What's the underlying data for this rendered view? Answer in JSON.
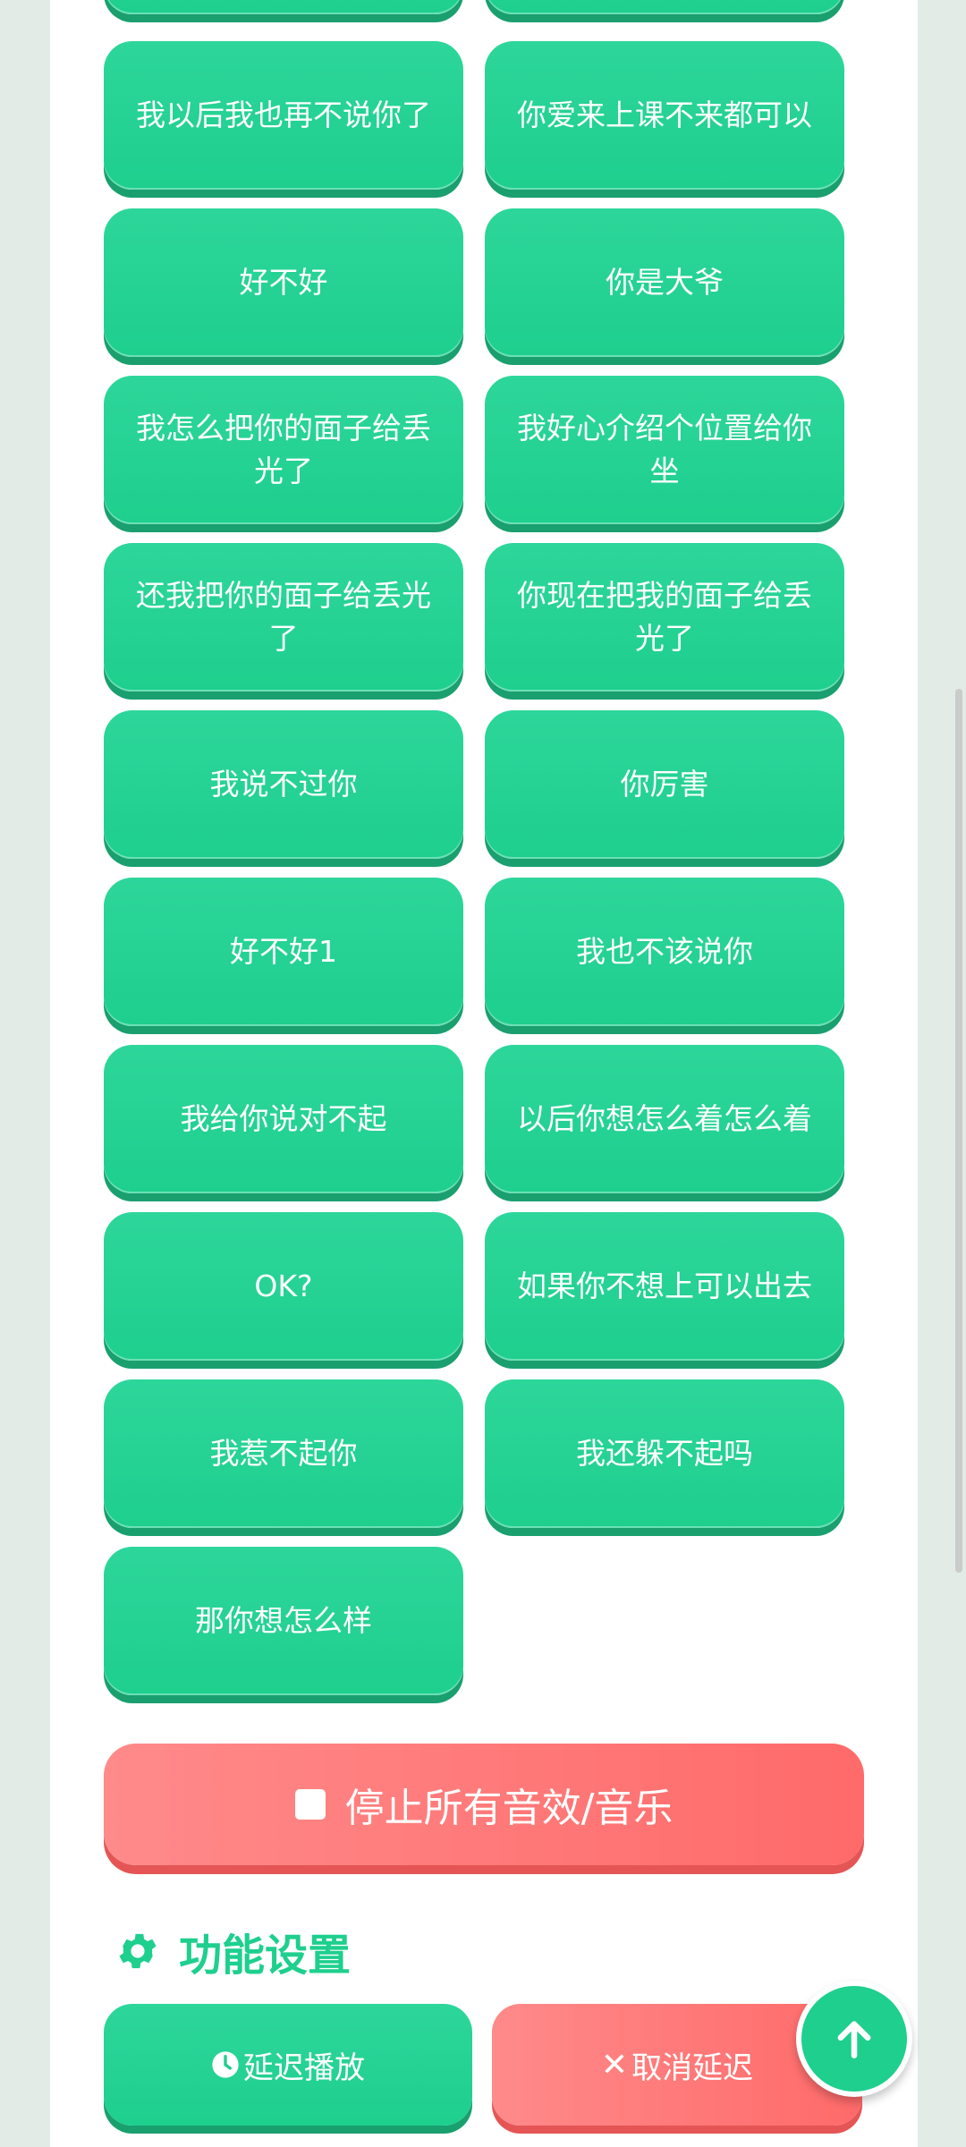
{
  "sound_buttons": [
    "我以后我也再不说你了",
    "你爱来上课不来都可以",
    "好不好",
    "你是大爷",
    "我怎么把你的面子给丢光了",
    "我好心介绍个位置给你坐",
    "还我把你的面子给丢光了",
    "你现在把我的面子给丢光了",
    "我说不过你",
    "你厉害",
    "好不好1",
    "我也不该说你",
    "我给你说对不起",
    "以后你想怎么着怎么着",
    "OK?",
    "如果你不想上可以出去",
    "我惹不起你",
    "我还躲不起吗",
    "那你想怎么样"
  ],
  "stop": {
    "label": "停止所有音效/音乐",
    "icon": "stop-square-icon"
  },
  "settings": {
    "title": "功能设置",
    "icon": "gear-icon",
    "delay_label": "延迟播放",
    "cancel_label": "取消延迟"
  },
  "fab": {
    "icon": "arrow-up-icon"
  },
  "colors": {
    "accent": "#1ecf8e",
    "danger": "#ff6a6a",
    "background": "#e3ebe7"
  }
}
